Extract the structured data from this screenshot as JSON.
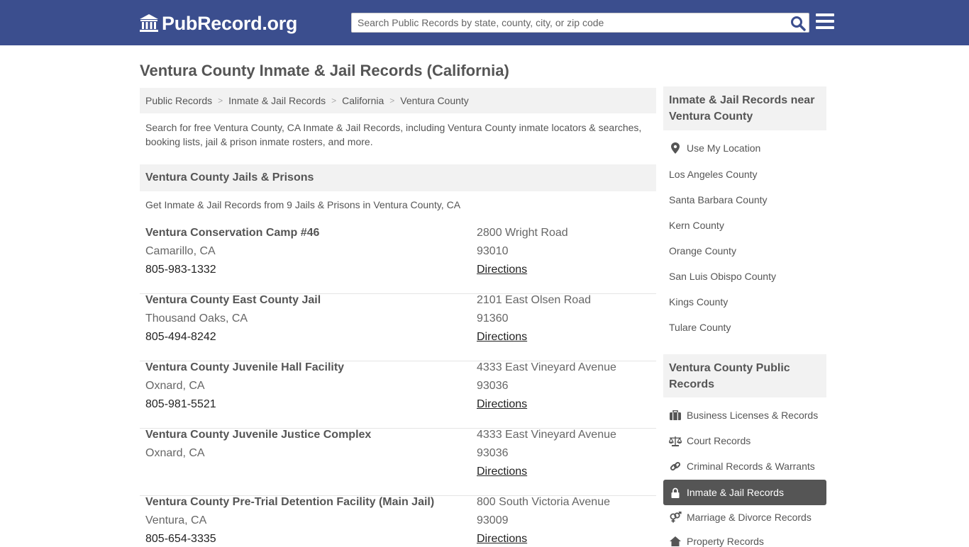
{
  "header": {
    "logo_text": "PubRecord.org",
    "search_placeholder": "Search Public Records by state, county, city, or zip code"
  },
  "page": {
    "title": "Ventura County Inmate & Jail Records (California)",
    "breadcrumb": [
      "Public Records",
      "Inmate & Jail Records",
      "California",
      "Ventura County"
    ],
    "intro": "Search for free Ventura County, CA Inmate & Jail Records, including Ventura County inmate locators & searches, booking lists, jail & prison inmate rosters, and more."
  },
  "section": {
    "title": "Ventura County Jails & Prisons",
    "subtitle": "Get Inmate & Jail Records from 9 Jails & Prisons in Ventura County, CA"
  },
  "listings": [
    {
      "name": "Ventura Conservation Camp #46",
      "city": "Camarillo, CA",
      "phone": "805-983-1332",
      "address": "2800 Wright Road",
      "zip": "93010",
      "directions": "Directions"
    },
    {
      "name": "Ventura County East County Jail",
      "city": "Thousand Oaks, CA",
      "phone": "805-494-8242",
      "address": "2101 East Olsen Road",
      "zip": "91360",
      "directions": "Directions"
    },
    {
      "name": "Ventura County Juvenile Hall Facility",
      "city": "Oxnard, CA",
      "phone": "805-981-5521",
      "address": "4333 East Vineyard Avenue",
      "zip": "93036",
      "directions": "Directions"
    },
    {
      "name": "Ventura County Juvenile Justice Complex",
      "city": "Oxnard, CA",
      "phone": "",
      "address": "4333 East Vineyard Avenue",
      "zip": "93036",
      "directions": "Directions"
    },
    {
      "name": "Ventura County Pre-Trial Detention Facility (Main Jail)",
      "city": "Ventura, CA",
      "phone": "805-654-3335",
      "address": "800 South Victoria Avenue",
      "zip": "93009",
      "directions": "Directions"
    }
  ],
  "sidebar": {
    "nearby_title": "Inmate & Jail Records near Ventura County",
    "use_location": "Use My Location",
    "nearby": [
      "Los Angeles County",
      "Santa Barbara County",
      "Kern County",
      "Orange County",
      "San Luis Obispo County",
      "Kings County",
      "Tulare County"
    ],
    "public_title": "Ventura County Public Records",
    "public_links": [
      {
        "label": "Business Licenses & Records",
        "icon": "briefcase-icon"
      },
      {
        "label": "Court Records",
        "icon": "scales-icon"
      },
      {
        "label": "Criminal Records & Warrants",
        "icon": "link-icon"
      },
      {
        "label": "Inmate & Jail Records",
        "icon": "lock-icon",
        "active": true
      },
      {
        "label": "Marriage & Divorce Records",
        "icon": "gender-icon"
      },
      {
        "label": "Property Records",
        "icon": "home-icon"
      }
    ]
  },
  "colors": {
    "header_bg": "#3b4e8e",
    "panel_bg": "#f2f2f2",
    "active_bg": "#555555"
  }
}
